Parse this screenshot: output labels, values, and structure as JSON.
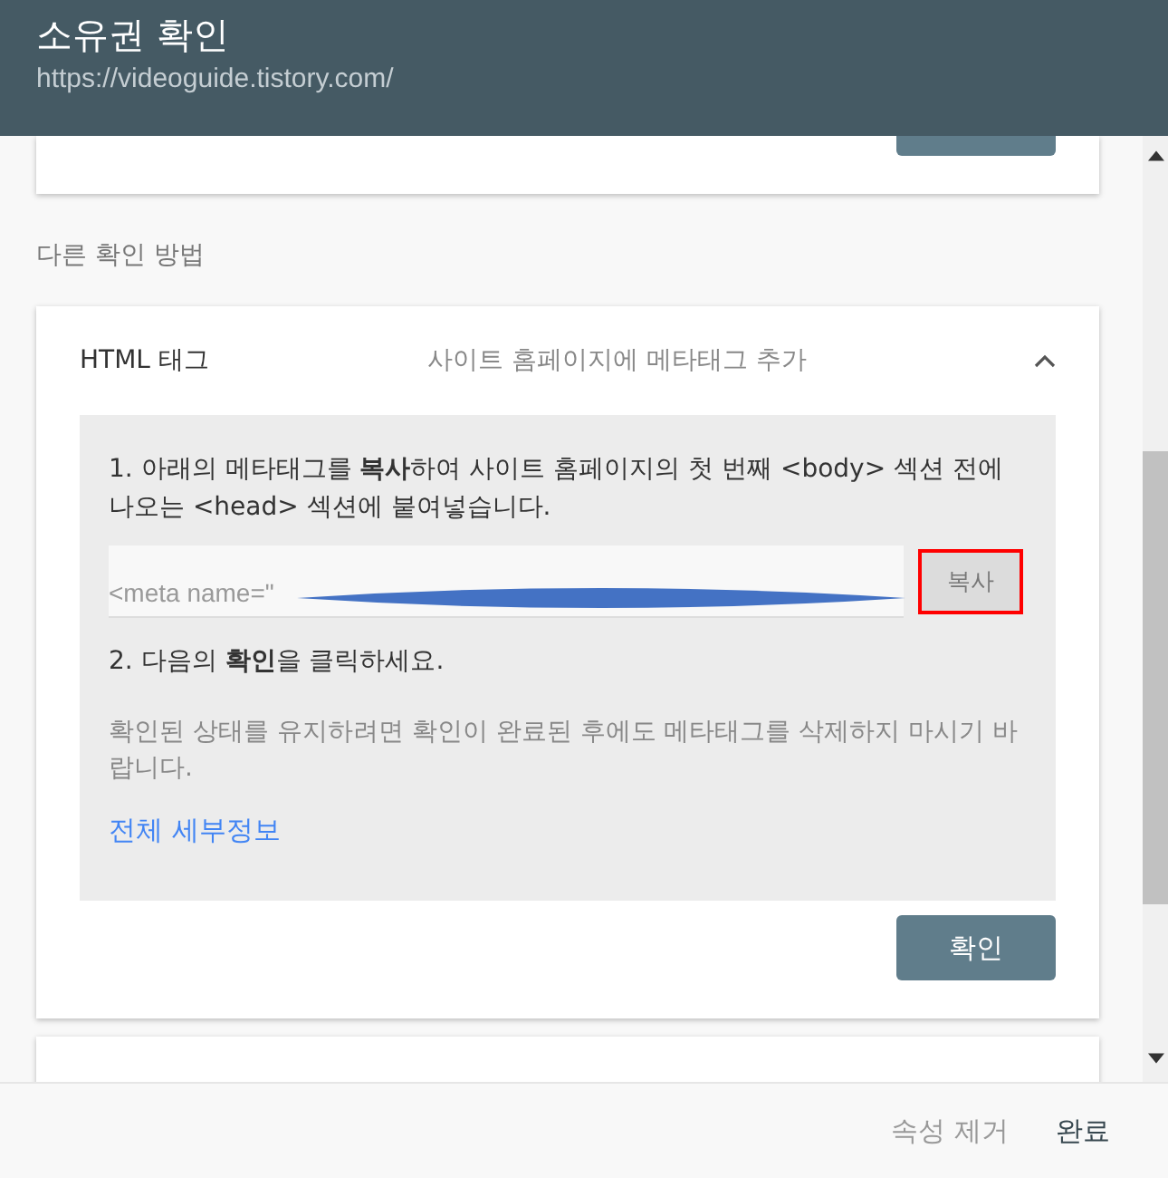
{
  "dialog": {
    "title": "소유권 확인",
    "url": "https://videoguide.tistory.com/"
  },
  "section_label": "다른 확인 방법",
  "method": {
    "title": "HTML 태그",
    "description": "사이트 홈페이지에 메타태그 추가",
    "expanded": true,
    "step_1": "1. 아래의 메타태그를 **복사**하여 사이트 홈페이지의 첫 번째 <body> 섹션 전에 나오는 <head> 섹션에 붙여넣습니다.",
    "meta_tag": "<meta name=\"",
    "copy_button": "복사",
    "copy_highlighted": true,
    "step_2": "2. 다음의 **확인**을 클릭하세요.",
    "note": "확인된 상태를 유지하려면 확인이 완료된 후에도 메타태그를 삭제하지 마시기 바랍니다.",
    "details_link": "전체 세부정보",
    "verify_button": "확인"
  },
  "footer": {
    "buttons": [
      {
        "label": "속성 제거",
        "kind": "secondary"
      },
      {
        "label": "완료",
        "kind": "primary"
      }
    ]
  }
}
